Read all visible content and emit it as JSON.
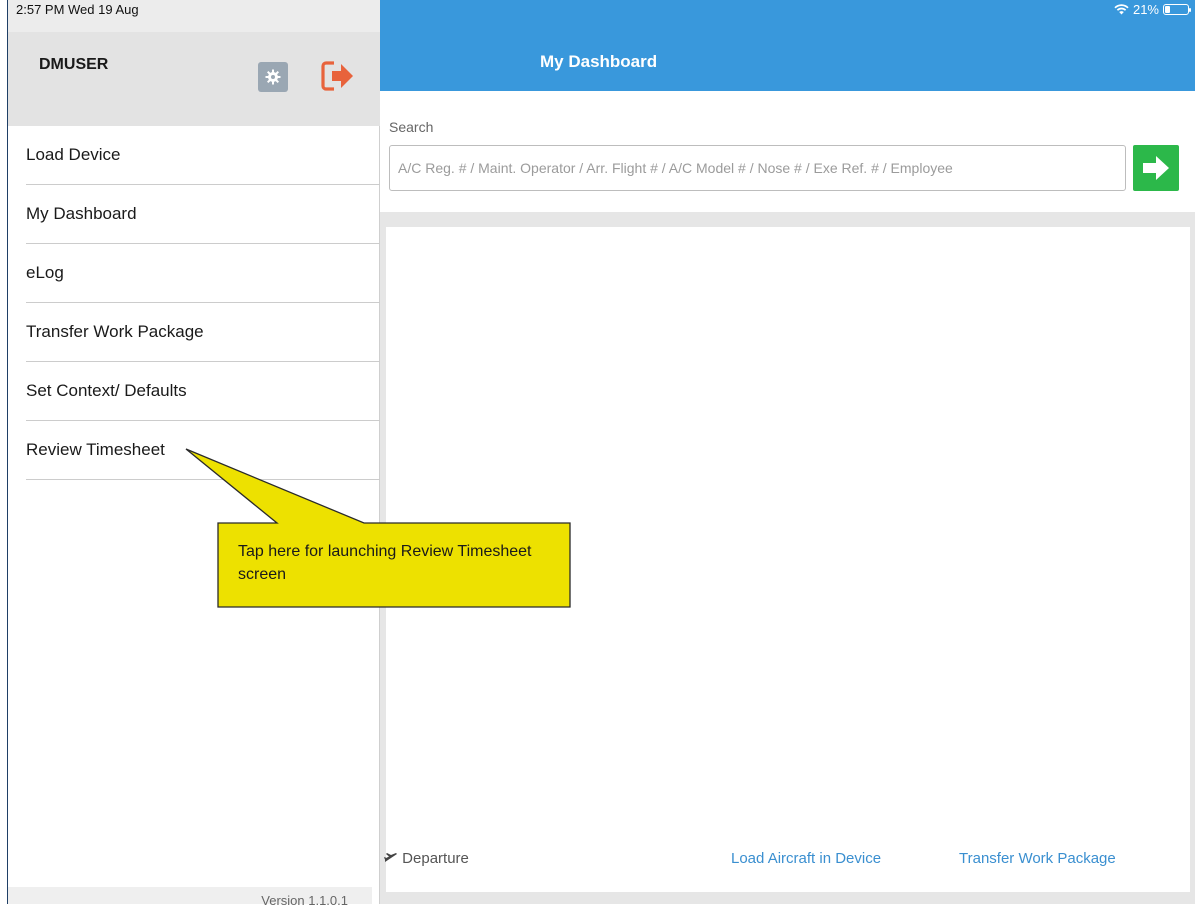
{
  "status_bar": {
    "time": "2:57 PM  Wed 19 Aug",
    "battery_text": "21%",
    "battery_level": 0.21
  },
  "sidebar": {
    "username": "DMUSER",
    "items": [
      {
        "label": "Load Device"
      },
      {
        "label": "My Dashboard"
      },
      {
        "label": "eLog"
      },
      {
        "label": "Transfer Work Package"
      },
      {
        "label": "Set Context/ Defaults"
      },
      {
        "label": "Review Timesheet"
      }
    ],
    "version": "Version 1.1.0.1"
  },
  "header": {
    "title": "My Dashboard"
  },
  "search": {
    "label": "Search",
    "placeholder": "A/C Reg. # / Maint. Operator / Arr. Flight # / A/C Model # / Nose # / Exe Ref. # / Employee"
  },
  "footer": {
    "departure": "Departure",
    "load_aircraft": "Load Aircraft in Device",
    "transfer_work_package": "Transfer Work Package"
  },
  "callout": {
    "text": "Tap here for launching Review Timesheet screen"
  },
  "colors": {
    "nav_blue": "#3998dc",
    "go_green": "#2cb84a",
    "logout_orange": "#e8633c",
    "callout_yellow": "#ede100",
    "link_blue": "#3a8fd0"
  },
  "icons": {
    "gear": "gear-icon",
    "logout": "logout-icon",
    "wifi": "wifi-icon",
    "battery": "battery-icon",
    "go": "arrow-right-icon",
    "departure": "plane-icon"
  }
}
